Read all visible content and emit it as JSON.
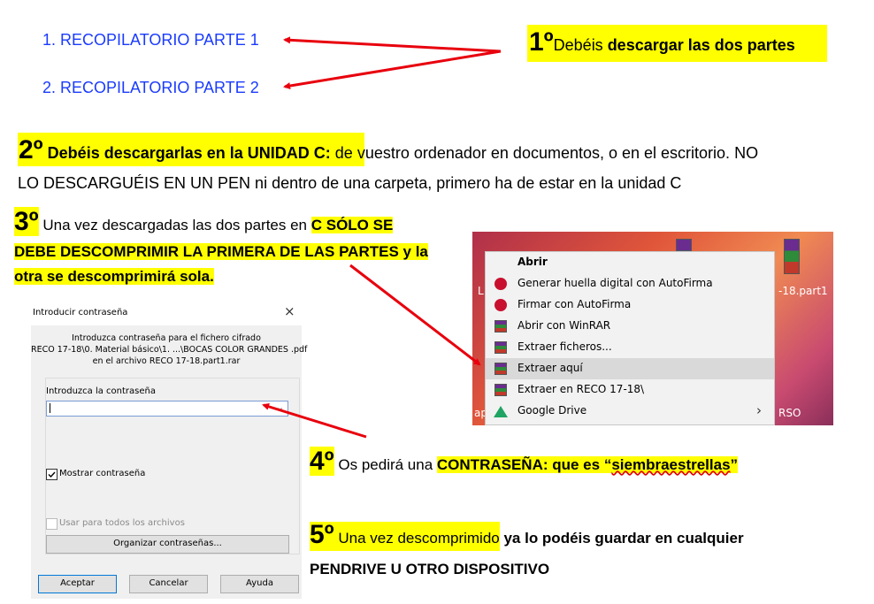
{
  "links": [
    {
      "label": "1. RECOPILATORIO PARTE 1"
    },
    {
      "label": "2. RECOPILATORIO PARTE 2"
    }
  ],
  "step1": {
    "num": "1º",
    "text": "Debéis ",
    "bold": "descargar las dos partes"
  },
  "step2": {
    "num": "2º",
    "bold": "Debéis descargarlas en la UNIDAD C:",
    "text1": " de vuestro ordenador en documentos, o en el escritorio. NO",
    "text2": "LO DESCARGUÉIS EN UN PEN ni dentro de una carpeta, primero ha de estar en la unidad C"
  },
  "step3": {
    "num": "3º",
    "text": " Una vez descargadas las dos partes en ",
    "bold1": "C  SÓLO SE",
    "bold2": "DEBE DESCOMPRIMIR LA PRIMERA DE LAS PARTES y la",
    "bold3": "otra se descomprimirá sola."
  },
  "step4": {
    "num": "4º",
    "text": " Os pedirá una ",
    "bold": "CONTRASEÑA: que es “",
    "password": "siembraestrellas",
    "end": "”"
  },
  "step5": {
    "num": "5º",
    "text": " Una vez descomprimido",
    "bold1": " ya lo podéis guardar en cualquier",
    "bold2": "PENDRIVE U OTRO DISPOSITIVO"
  },
  "dialog": {
    "title": "Introducir contraseña",
    "close": "×",
    "info1": "Introduzca contraseña para el fichero cifrado",
    "info2": "RECO 17-18\\0. Material básico\\1. ...\\BOCAS  COLOR GRANDES .pdf",
    "info3": "en el archivo RECO 17-18.part1.rar",
    "field_label": "Introduzca la contraseña",
    "field_value": "",
    "show_password": "Mostrar contraseña",
    "use_all": "Usar para todos los archivos",
    "organize": "Organizar contraseñas...",
    "ok": "Aceptar",
    "cancel": "Cancelar",
    "help": "Ayuda"
  },
  "context_menu": {
    "items": [
      {
        "label": "Abrir",
        "icon": "none"
      },
      {
        "label": "Generar huella digital con AutoFirma",
        "icon": "autofirma-icon"
      },
      {
        "label": "Firmar con AutoFirma",
        "icon": "autofirma-icon"
      },
      {
        "label": "Abrir con WinRAR",
        "icon": "winrar-icon"
      },
      {
        "label": "Extraer ficheros...",
        "icon": "winrar-icon"
      },
      {
        "label": "Extraer aquí",
        "icon": "winrar-icon"
      },
      {
        "label": "Extraer en RECO 17-18\\",
        "icon": "winrar-icon"
      },
      {
        "label": "Google Drive",
        "icon": "google-drive-icon"
      }
    ],
    "bg_fragments": [
      "-18.part1",
      "RSO",
      "L",
      "ap"
    ]
  },
  "colors": {
    "highlight": "#ffff00",
    "link": "#1a3bff",
    "arrow": "#e8000d"
  }
}
